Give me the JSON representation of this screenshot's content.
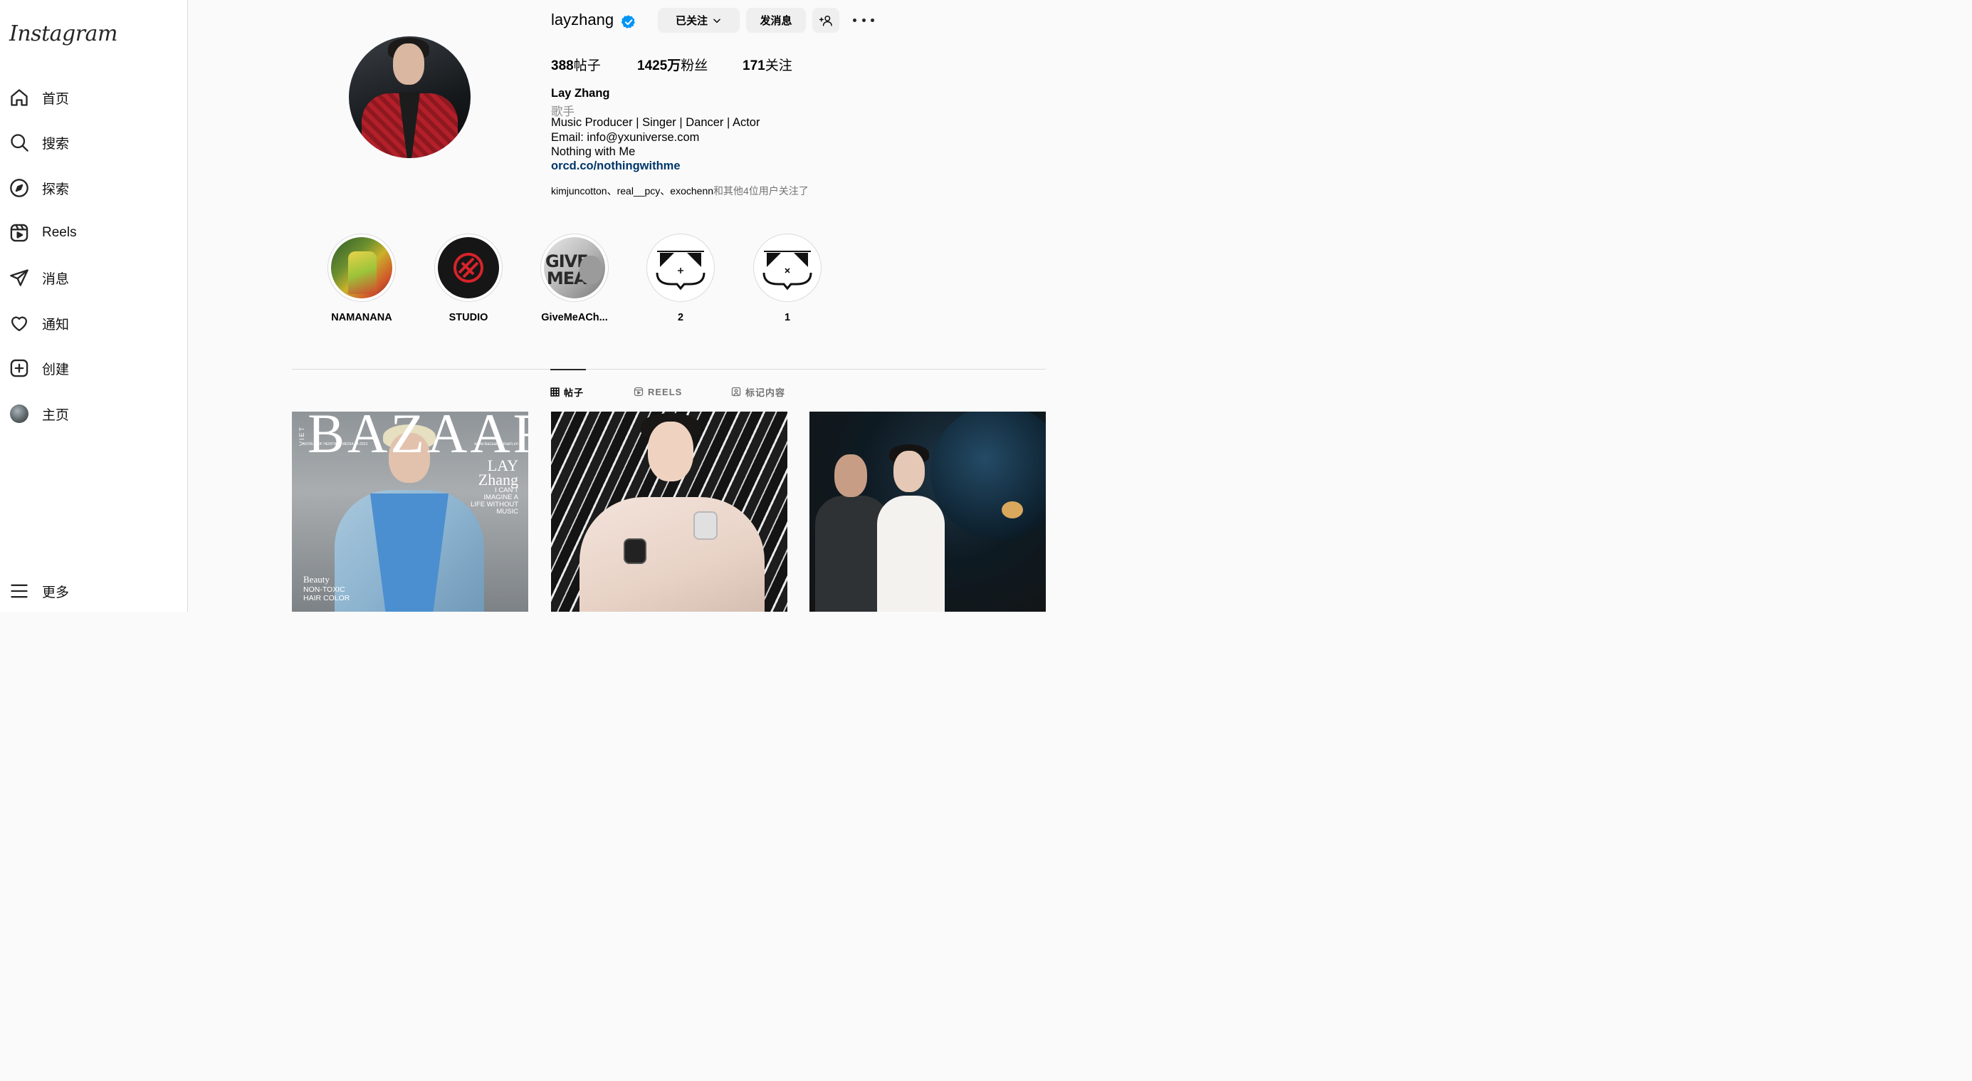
{
  "sidebar": {
    "logo": "Instagram",
    "items": [
      {
        "label": "首页",
        "icon": "home-icon"
      },
      {
        "label": "搜索",
        "icon": "search-icon"
      },
      {
        "label": "探索",
        "icon": "compass-icon"
      },
      {
        "label": "Reels",
        "icon": "reels-icon"
      },
      {
        "label": "消息",
        "icon": "paper-plane-icon"
      },
      {
        "label": "通知",
        "icon": "heart-icon"
      },
      {
        "label": "创建",
        "icon": "plus-square-icon"
      },
      {
        "label": "主页",
        "icon": "avatar-icon"
      }
    ],
    "more": {
      "label": "更多",
      "icon": "menu-icon"
    }
  },
  "profile": {
    "username": "layzhang",
    "follow_button": "已关注",
    "message_button": "发消息",
    "add_user_icon": "add-user-icon",
    "stats": {
      "posts_count": "388",
      "posts_label": "帖子",
      "followers_count": "1425万",
      "followers_label": "粉丝",
      "following_count": "171",
      "following_label": "关注"
    },
    "bio": {
      "name": "Lay Zhang",
      "category": "歌手",
      "line1": "Music Producer | Singer | Dancer | Actor",
      "line2": "Email: info@yxuniverse.com",
      "line3": "Nothing with Me",
      "link": "orcd.co/nothingwithme"
    },
    "followed_by_names": "kimjuncotton、real__pcy、exochenn",
    "followed_by_suffix": "和其他4位用户关注了"
  },
  "highlights": [
    {
      "label": "NAMANANA"
    },
    {
      "label": "STUDIO"
    },
    {
      "label": "GiveMeACh..."
    },
    {
      "label": "2"
    },
    {
      "label": "1"
    }
  ],
  "tabs": [
    {
      "label": "帖子",
      "icon": "grid-icon",
      "active": true
    },
    {
      "label": "REELS",
      "icon": "reels-icon",
      "active": false
    },
    {
      "label": "标记内容",
      "icon": "tagged-icon",
      "active": false
    }
  ],
  "posts": {
    "post1": {
      "masthead": "BAZAAR",
      "edition": "VIET",
      "subline": "WORLD OF HERITAGE MEDIA | 4-2023",
      "website": "www.bazaarvietnam.vn",
      "cover_name_1": "LAY",
      "cover_name_2": "Zhang",
      "quote": "I CAN'T IMAGINE A LIFE WITHOUT MUSIC",
      "beauty": "Beauty",
      "beauty_sub": "NON-TOXIC HAIR COLOR"
    }
  },
  "colors": {
    "link": "#00376b",
    "verified": "#0095f6",
    "button_bg": "#efefef",
    "border": "#dbdbdb"
  }
}
